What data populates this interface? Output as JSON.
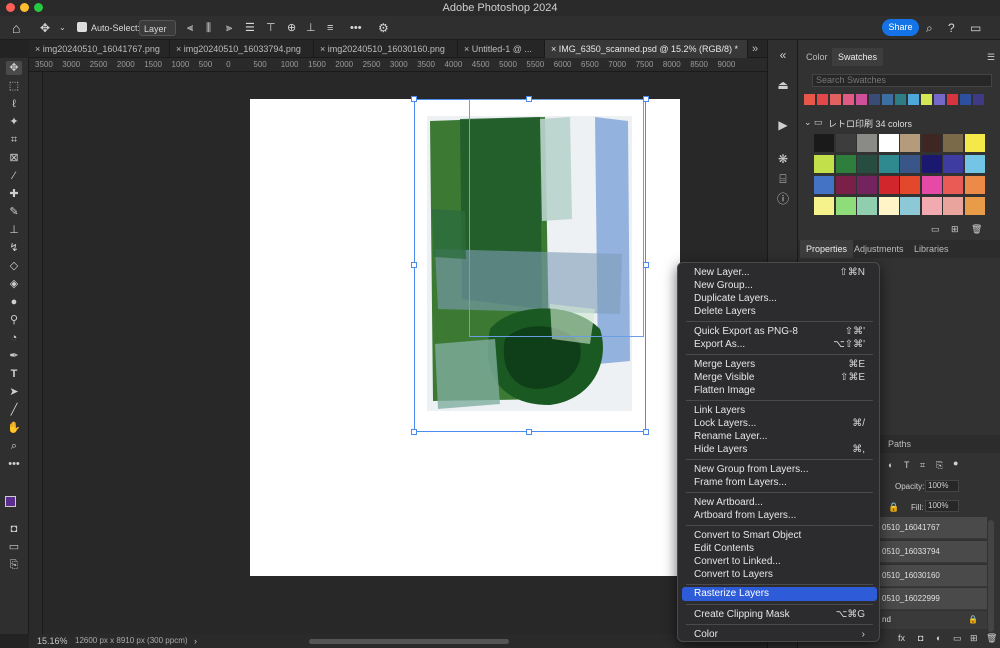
{
  "app": {
    "title": "Adobe Photoshop 2024"
  },
  "options": {
    "auto_select_label": "Auto-Select:",
    "layer_select": "Layer",
    "share_label": "Share",
    "dots": "•••"
  },
  "tabs": [
    {
      "label": "img20240510_16041767.png"
    },
    {
      "label": "img20240510_16033794.png"
    },
    {
      "label": "img20240510_16030160.png"
    },
    {
      "label": "Untitled-1 @ ..."
    },
    {
      "label": "IMG_6350_scanned.psd @ 15.2% (RGB/8) *"
    }
  ],
  "ruler": {
    "ticks": [
      "3500",
      "3000",
      "2500",
      "2000",
      "1500",
      "1000",
      "500",
      "0",
      "500",
      "1000",
      "1500",
      "2000",
      "2500",
      "3000",
      "3500",
      "4000",
      "4500",
      "5000",
      "5500",
      "6000",
      "6500",
      "7000",
      "7500",
      "8000",
      "8500",
      "9000"
    ]
  },
  "status": {
    "zoom": "15.16%",
    "info": "12600 px x 8910 px (300 ppcm)",
    "arrow": "›"
  },
  "panels": {
    "color_tab": "Color",
    "swatches_tab": "Swatches",
    "search_placeholder": "Search Swatches",
    "group_name": "レトロ印刷 34 colors",
    "properties_tab": "Properties",
    "adjustments_tab": "Adjustments",
    "libraries_tab": "Libraries",
    "paths_tab": "Paths",
    "opacity_label": "Opacity:",
    "opacity_value": "100%",
    "fill_label": "Fill:",
    "fill_value": "100%"
  },
  "recent_swatches": [
    "#e8574a",
    "#e3474a",
    "#e36060",
    "#e05a84",
    "#cf4f9b",
    "#3a4b78",
    "#3b6fa3",
    "#2d7d85",
    "#4da7d8",
    "#d4e855",
    "#7468c8",
    "#d6343f",
    "#2d4fa0",
    "#3e3a86"
  ],
  "swatch_grid": [
    "#1a1a1a",
    "#3d3d3d",
    "#8a8a86",
    "#ffffff",
    "#b49b7c",
    "#3e2722",
    "#7b6a49",
    "#f5e94a",
    "#c2e04a",
    "#2e7f3b",
    "#264d40",
    "#2e8a8e",
    "#3a5587",
    "#1b1870",
    "#3e3ca0",
    "#72c5e5",
    "#4472c4",
    "#7a1f48",
    "#73245f",
    "#d0262c",
    "#e4482c",
    "#e64aa6",
    "#ea5b55",
    "#ec8a48",
    "#f5f28c",
    "#8edc7a",
    "#8fcfb0",
    "#fff4c7",
    "#8dc8d6",
    "#f0aab0",
    "#e9a49e",
    "#e89b49"
  ],
  "layers": [
    {
      "name": "0510_16041767"
    },
    {
      "name": "0510_16033794"
    },
    {
      "name": "0510_16030160"
    },
    {
      "name": "0510_16022999"
    },
    {
      "name": "nd"
    }
  ],
  "context_menu": [
    {
      "label": "New Layer...",
      "shortcut": "⇧⌘N"
    },
    {
      "label": "New Group...",
      "shortcut": ""
    },
    {
      "label": "Duplicate Layers...",
      "shortcut": ""
    },
    {
      "label": "Delete Layers",
      "shortcut": ""
    },
    {
      "label": "Quick Export as PNG-8",
      "shortcut": "⇧⌘'"
    },
    {
      "label": "Export As...",
      "shortcut": "⌥⇧⌘'"
    },
    {
      "label": "Merge Layers",
      "shortcut": "⌘E"
    },
    {
      "label": "Merge Visible",
      "shortcut": "⇧⌘E"
    },
    {
      "label": "Flatten Image",
      "shortcut": ""
    },
    {
      "label": "Link Layers",
      "shortcut": ""
    },
    {
      "label": "Lock Layers...",
      "shortcut": "⌘/"
    },
    {
      "label": "Rename Layer...",
      "shortcut": ""
    },
    {
      "label": "Hide Layers",
      "shortcut": "⌘,"
    },
    {
      "label": "New Group from Layers...",
      "shortcut": ""
    },
    {
      "label": "Frame from Layers...",
      "shortcut": ""
    },
    {
      "label": "New Artboard...",
      "shortcut": ""
    },
    {
      "label": "Artboard from Layers...",
      "shortcut": ""
    },
    {
      "label": "Convert to Smart Object",
      "shortcut": ""
    },
    {
      "label": "Edit Contents",
      "shortcut": ""
    },
    {
      "label": "Convert to Linked...",
      "shortcut": ""
    },
    {
      "label": "Convert to Layers",
      "shortcut": ""
    },
    {
      "label": "Rasterize Layers",
      "shortcut": ""
    },
    {
      "label": "Create Clipping Mask",
      "shortcut": "⌥⌘G"
    },
    {
      "label": "Color",
      "shortcut": "›"
    }
  ]
}
